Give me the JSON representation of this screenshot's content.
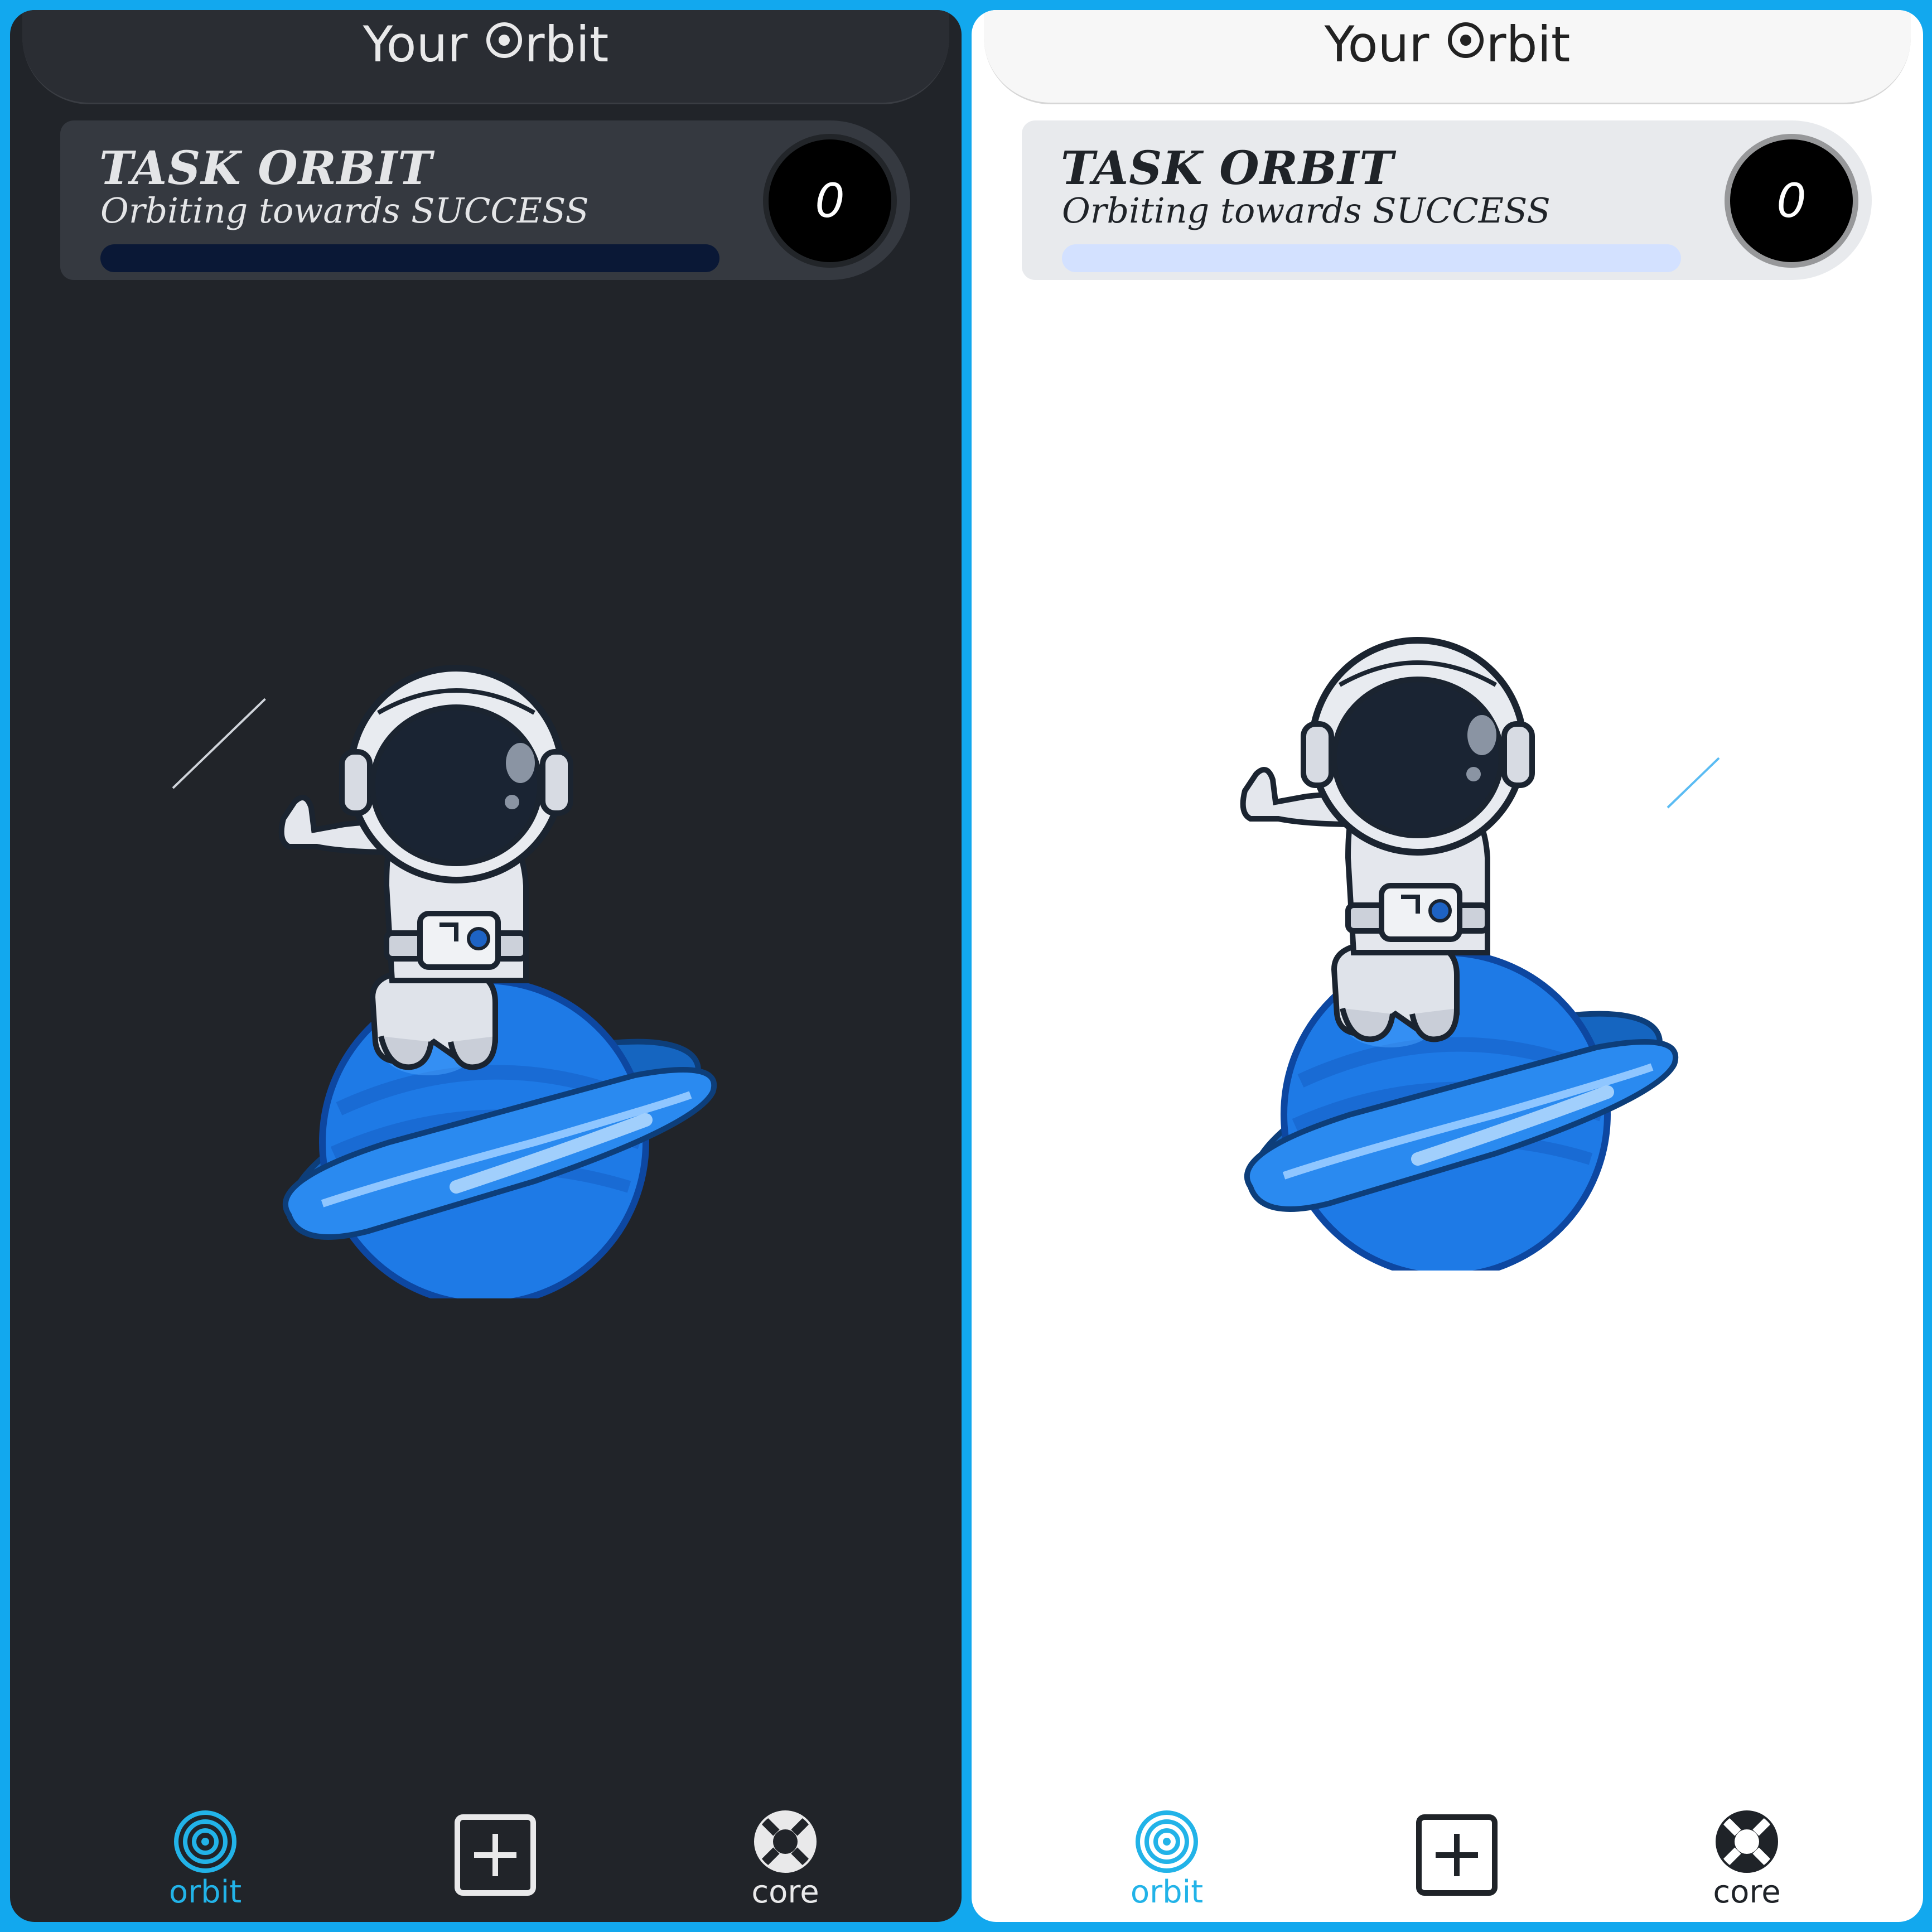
{
  "theme_colors": {
    "accent": "#22b3e8",
    "frame": "#12a8ee",
    "dark_bg": "#212429",
    "light_bg": "#ffffff"
  },
  "panels": [
    {
      "theme": "dark",
      "appbar": {
        "title_prefix": "Your ",
        "title_suffix": "rbit",
        "logo_icon": "orbit-o-icon"
      },
      "card": {
        "title": "TASK ORBIT",
        "subtitle": "Orbiting towards SUCCESS",
        "progress": 0,
        "counter": "0"
      },
      "illustration": "astronaut-on-planet",
      "nav": [
        {
          "label": "orbit",
          "icon": "orbit-icon",
          "active": true
        },
        {
          "label": "",
          "icon": "add-square-icon",
          "active": false
        },
        {
          "label": "core",
          "icon": "lifebuoy-icon",
          "active": false
        }
      ]
    },
    {
      "theme": "light",
      "appbar": {
        "title_prefix": "Your ",
        "title_suffix": "rbit",
        "logo_icon": "orbit-o-icon"
      },
      "card": {
        "title": "TASK ORBIT",
        "subtitle": "Orbiting towards SUCCESS",
        "progress": 0,
        "counter": "0"
      },
      "illustration": "astronaut-on-planet",
      "nav": [
        {
          "label": "orbit",
          "icon": "orbit-icon",
          "active": true
        },
        {
          "label": "",
          "icon": "add-square-icon",
          "active": false
        },
        {
          "label": "core",
          "icon": "lifebuoy-icon",
          "active": false
        }
      ]
    }
  ]
}
